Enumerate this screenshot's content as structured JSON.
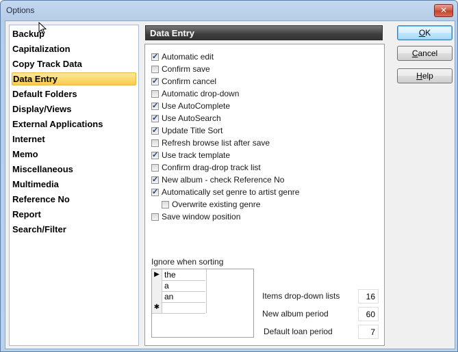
{
  "window": {
    "title": "Options",
    "close_label": "✕"
  },
  "categories": [
    {
      "label": "Backup",
      "selected": false
    },
    {
      "label": "Capitalization",
      "selected": false
    },
    {
      "label": "Copy Track Data",
      "selected": false
    },
    {
      "label": "Data Entry",
      "selected": true
    },
    {
      "label": "Default Folders",
      "selected": false
    },
    {
      "label": "Display/Views",
      "selected": false
    },
    {
      "label": "External Applications",
      "selected": false
    },
    {
      "label": "Internet",
      "selected": false
    },
    {
      "label": "Memo",
      "selected": false
    },
    {
      "label": "Miscellaneous",
      "selected": false
    },
    {
      "label": "Multimedia",
      "selected": false
    },
    {
      "label": "Reference No",
      "selected": false
    },
    {
      "label": "Report",
      "selected": false
    },
    {
      "label": "Search/Filter",
      "selected": false
    }
  ],
  "panel": {
    "title": "Data Entry",
    "options": [
      {
        "label": "Automatic edit",
        "checked": true,
        "indent": false
      },
      {
        "label": "Confirm save",
        "checked": false,
        "indent": false
      },
      {
        "label": "Confirm cancel",
        "checked": true,
        "indent": false
      },
      {
        "label": "Automatic drop-down",
        "checked": false,
        "indent": false
      },
      {
        "label": "Use AutoComplete",
        "checked": true,
        "indent": false
      },
      {
        "label": "Use AutoSearch",
        "checked": true,
        "indent": false
      },
      {
        "label": "Update Title Sort",
        "checked": true,
        "indent": false
      },
      {
        "label": "Refresh browse list after save",
        "checked": false,
        "indent": false
      },
      {
        "label": "Use track template",
        "checked": true,
        "indent": false
      },
      {
        "label": "Confirm drag-drop track list",
        "checked": false,
        "indent": false
      },
      {
        "label": "New album - check Reference No",
        "checked": true,
        "indent": false
      },
      {
        "label": "Automatically set genre to artist genre",
        "checked": true,
        "indent": false
      },
      {
        "label": "Overwrite existing genre",
        "checked": false,
        "indent": true
      },
      {
        "label": "Save window position",
        "checked": false,
        "indent": false
      }
    ],
    "ignore_sorting": {
      "label": "Ignore when sorting",
      "rows": [
        {
          "marker": "▶",
          "value": "the"
        },
        {
          "marker": "",
          "value": "a"
        },
        {
          "marker": "",
          "value": "an"
        },
        {
          "marker": "✱",
          "value": ""
        }
      ]
    },
    "fields": [
      {
        "label": "Items drop-down lists",
        "value": "16"
      },
      {
        "label": "New album period",
        "value": "60"
      },
      {
        "label": "Default loan period",
        "value": "7"
      }
    ]
  },
  "buttons": {
    "ok": {
      "accel": "O",
      "rest": "K"
    },
    "cancel": {
      "accel": "C",
      "rest": "ancel"
    },
    "help": {
      "accel": "H",
      "rest": "elp"
    }
  }
}
